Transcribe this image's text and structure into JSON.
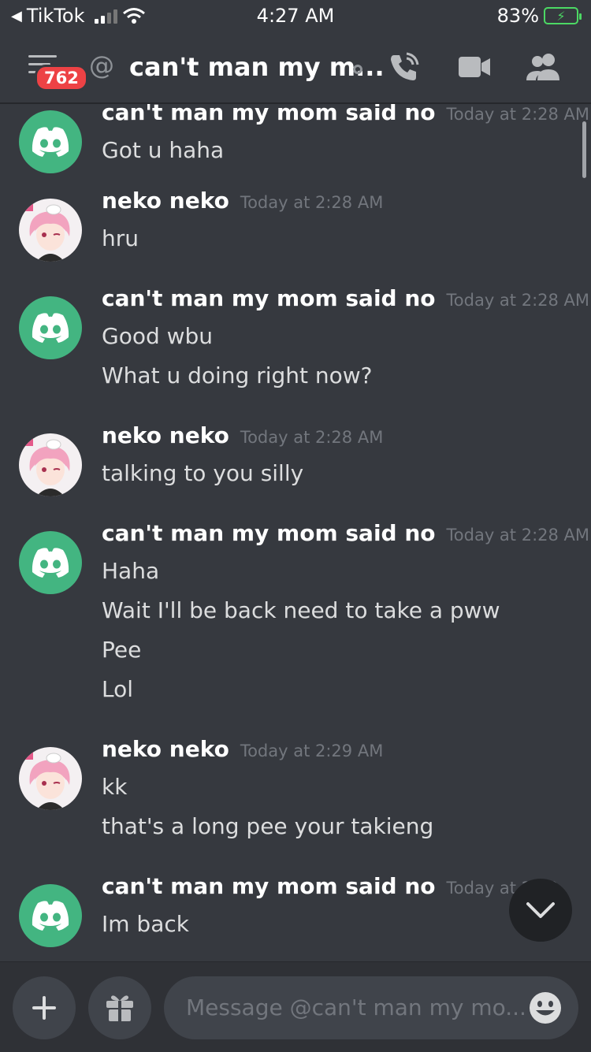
{
  "status_bar": {
    "back_app": "TikTok",
    "time": "4:27 AM",
    "battery": "83%"
  },
  "header": {
    "badge_count": "762",
    "at_symbol": "@",
    "title": "can't man my m..."
  },
  "messages": [
    {
      "author": "can't man my mom said no",
      "timestamp": "Today at 2:28 AM",
      "avatar": "discord-logo",
      "lines": [
        "Got u haha"
      ]
    },
    {
      "author": "neko neko",
      "timestamp": "Today at 2:28 AM",
      "avatar": "anime-girl",
      "lines": [
        "hru"
      ]
    },
    {
      "author": "can't man my mom said no",
      "timestamp": "Today at 2:28 AM",
      "avatar": "discord-logo",
      "lines": [
        "Good wbu",
        "What u doing right now?"
      ]
    },
    {
      "author": "neko neko",
      "timestamp": "Today at 2:28 AM",
      "avatar": "anime-girl",
      "lines": [
        "talking to you silly"
      ]
    },
    {
      "author": "can't man my mom said no",
      "timestamp": "Today at 2:28 AM",
      "avatar": "discord-logo",
      "lines": [
        "Haha",
        "Wait I'll be back need to take a pww",
        "Pee",
        "Lol"
      ]
    },
    {
      "author": "neko neko",
      "timestamp": "Today at 2:29 AM",
      "avatar": "anime-girl",
      "lines": [
        "kk",
        "that's a long pee your takieng"
      ]
    },
    {
      "author": "can't man my mom said no",
      "timestamp": "Today at 2:32",
      "avatar": "discord-logo",
      "lines": [
        "Im back"
      ]
    }
  ],
  "composer": {
    "placeholder": "Message @can't man my mo..."
  },
  "colors": {
    "background": "#36393f",
    "discord_green": "#43b581",
    "badge_red": "#ed4245",
    "battery_green": "#4cd964"
  }
}
